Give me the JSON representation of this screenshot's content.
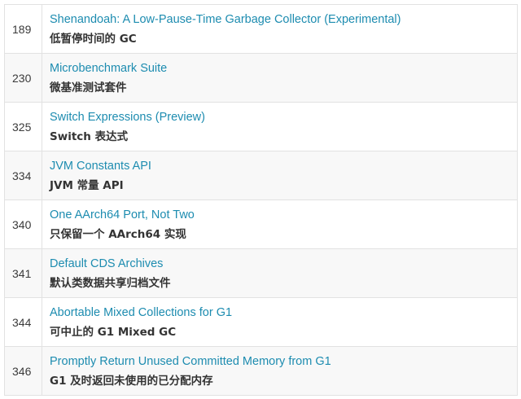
{
  "colors": {
    "link": "#1d8cb0",
    "text": "#333333",
    "border": "#e2e2e2",
    "row_alt": "#f8f8f8"
  },
  "rows": [
    {
      "jep": "189",
      "title": "Shenandoah: A Low-Pause-Time Garbage Collector (Experimental)",
      "cn": "低暂停时间的 GC"
    },
    {
      "jep": "230",
      "title": "Microbenchmark Suite",
      "cn": "微基准测试套件"
    },
    {
      "jep": "325",
      "title": "Switch Expressions (Preview)",
      "cn": "Switch 表达式"
    },
    {
      "jep": "334",
      "title": "JVM Constants API",
      "cn": "JVM 常量 API"
    },
    {
      "jep": "340",
      "title": "One AArch64 Port, Not Two",
      "cn": "只保留一个 AArch64 实现"
    },
    {
      "jep": "341",
      "title": "Default CDS Archives",
      "cn": "默认类数据共享归档文件"
    },
    {
      "jep": "344",
      "title": "Abortable Mixed Collections for G1",
      "cn": "可中止的 G1 Mixed GC"
    },
    {
      "jep": "346",
      "title": "Promptly Return Unused Committed Memory from G1",
      "cn": "G1 及时返回未使用的已分配内存"
    }
  ]
}
